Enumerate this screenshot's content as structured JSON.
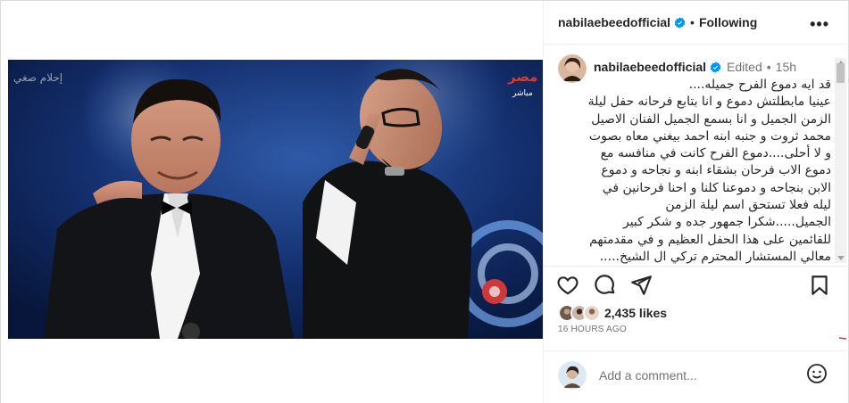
{
  "header": {
    "username": "nabilaebeedofficial",
    "separator": "•",
    "follow_label": "Following",
    "more_label": "•••"
  },
  "caption": {
    "username": "nabilaebeedofficial",
    "edited_label": "Edited",
    "separator": "•",
    "time": "15h",
    "text": "قد ايه دموع الفرح جميله....\nعينيا مابطلتش دموع و انا بتابع فرحانه حفل ليلة الزمن الجميل و انا بسمع الجميل الفنان الاصيل محمد ثروت و جنبه ابنه احمد بيغني معاه بصوت و لا أحلى....دموع الفرح كانت في منافسه مع دموع الاب فرحان بشقاء ابنه و نجاحه و دموع الابن بنجاحه و دموعنا كلنا و احنا فرحانين في ليله فعلا تستحق اسم ليلة الزمن الجميل.....شكرا جمهور جده و شكر كبير للقائمين على هذا الحفل العظيم و في مقدمتهم معالي المستشار المحترم تركي ال الشيخ....."
  },
  "actions": {
    "like_icon": "heart-icon",
    "comment_icon": "comment-icon",
    "share_icon": "share-icon",
    "save_icon": "bookmark-icon"
  },
  "likes": {
    "count_text": "2,435 likes"
  },
  "timestamp": "16 HOURS AGO",
  "comment_box": {
    "placeholder": "Add a comment...",
    "emoji_icon": "emoji-icon"
  },
  "media": {
    "watermark": "إحلام صغي",
    "channel_logo": "مصر",
    "channel_sub": "مباشر"
  },
  "colors": {
    "verified": "#0095f6",
    "text": "#262626",
    "muted": "#737373",
    "border": "#dbdbdb"
  }
}
